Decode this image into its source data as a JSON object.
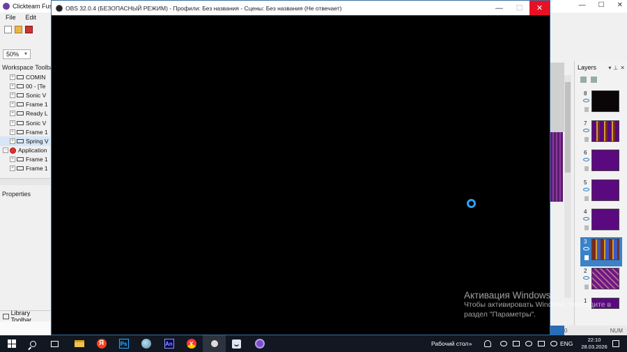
{
  "background_app": {
    "title": "Clickteam Fusi",
    "menu": [
      "File",
      "Edit"
    ],
    "zoom": "50%",
    "workspace_title": "Workspace Toolba",
    "tree": [
      {
        "label": "COMIN",
        "root": false
      },
      {
        "label": "00 - [Te",
        "root": false
      },
      {
        "label": "Sonic V",
        "root": false
      },
      {
        "label": "Frame 1",
        "root": false
      },
      {
        "label": "Ready L",
        "root": false
      },
      {
        "label": "Sonic V",
        "root": false
      },
      {
        "label": "Frame 1",
        "root": false
      },
      {
        "label": "Spring V",
        "root": false,
        "selected": true
      },
      {
        "label": "Application",
        "root": true
      },
      {
        "label": "Frame 1",
        "root": false
      },
      {
        "label": "Frame 1",
        "root": false
      }
    ],
    "properties_title": "Properties",
    "library_title": "Library Toolbar",
    "layers_title": "Layers",
    "layers": [
      {
        "num": "8",
        "style": "dark"
      },
      {
        "num": "7",
        "style": "mix"
      },
      {
        "num": "6",
        "style": "purple"
      },
      {
        "num": "5",
        "style": "purple"
      },
      {
        "num": "4",
        "style": "purple"
      },
      {
        "num": "3",
        "style": "mix2",
        "selected": true
      },
      {
        "num": "2",
        "style": "pink"
      },
      {
        "num": "1",
        "style": "purple"
      }
    ],
    "status_left": "0",
    "status_right": "NUM"
  },
  "obs": {
    "title": "OBS 32.0.4 (БЕЗОПАСНЫЙ РЕЖИМ) - Профили: Без названия - Сцены: Без названия (Не отвечает)",
    "minimize": "—",
    "maximize": "☐",
    "close": "✕"
  },
  "activation": {
    "title": "Активация Windows",
    "line1": "Чтобы активировать Windows, перейдите в",
    "line2": "раздел \"Параметры\"."
  },
  "taskbar": {
    "desktop_label": "Рабочий стол",
    "overflow": "»",
    "language": "ENG",
    "time": "22:10",
    "date": "28.03.2026",
    "apps": [
      "start-icon",
      "search-icon",
      "task-view-icon",
      "file-explorer-icon",
      "yandex-icon",
      "photoshop-icon",
      "globe-app-icon",
      "animate-icon",
      "yandex-browser-icon",
      "obs-icon",
      "pinned-app-icon",
      "clickteam-fusion-icon"
    ]
  }
}
